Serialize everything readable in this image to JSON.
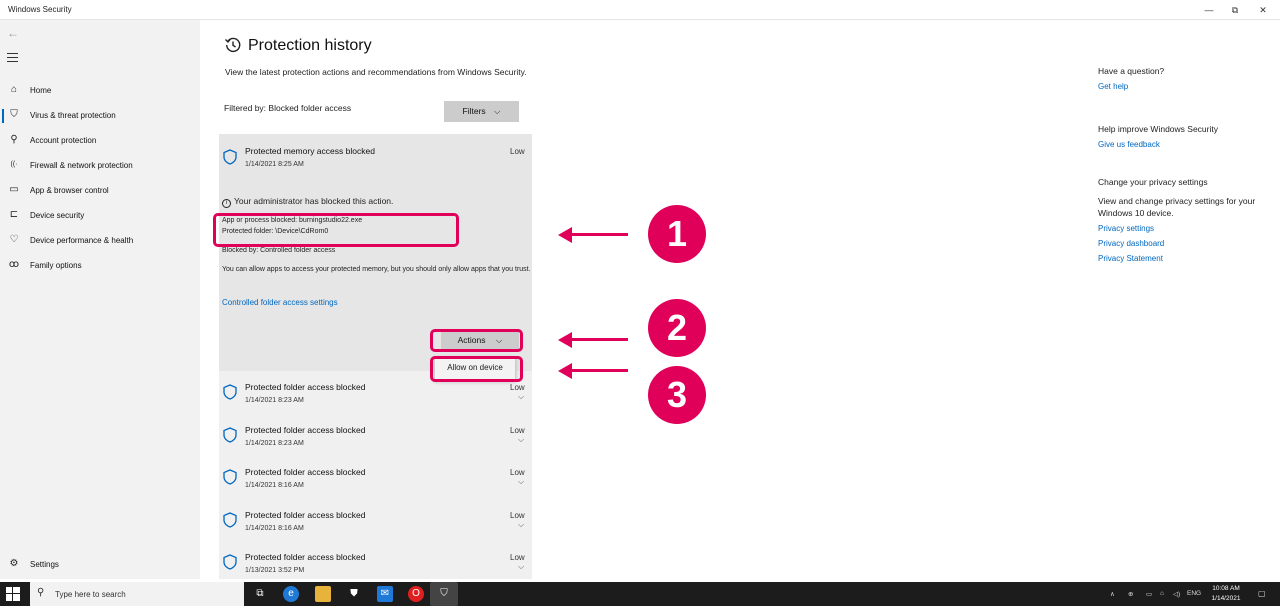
{
  "window": {
    "title": "Windows Security",
    "minimize": "—",
    "restore": "⧉",
    "close": "✕"
  },
  "sidebar": {
    "items": [
      {
        "label": "Home",
        "icon": "home-icon",
        "glyph": "⌂"
      },
      {
        "label": "Virus & threat protection",
        "icon": "shield-icon",
        "glyph": "⛉",
        "active": true
      },
      {
        "label": "Account protection",
        "icon": "person-icon",
        "glyph": "⚲"
      },
      {
        "label": "Firewall & network protection",
        "icon": "wifi-icon",
        "glyph": "((·"
      },
      {
        "label": "App & browser control",
        "icon": "window-icon",
        "glyph": "▭"
      },
      {
        "label": "Device security",
        "icon": "laptop-icon",
        "glyph": "⊏"
      },
      {
        "label": "Device performance & health",
        "icon": "heart-icon",
        "glyph": "♡"
      },
      {
        "label": "Family options",
        "icon": "family-icon",
        "glyph": "ꝏ"
      }
    ],
    "settings_label": "Settings"
  },
  "main": {
    "title": "Protection history",
    "description": "View the latest protection actions and recommendations from Windows Security.",
    "filter_label": "Filtered by: Blocked folder access",
    "filters_button": "Filters"
  },
  "expanded_item": {
    "title": "Protected memory access blocked",
    "date": "1/14/2021 8:25 AM",
    "severity": "Low",
    "admin_notice": "Your administrator has blocked this action.",
    "app_blocked": "App or process blocked: burningstudio22.exe",
    "protected_folder": "Protected folder: \\Device\\CdRom0",
    "blocked_by": "Blocked by: Controlled folder access",
    "info": "You can allow apps to access your protected memory, but you should only allow apps that you trust.",
    "settings_link": "Controlled folder access settings",
    "actions_button": "Actions",
    "dropdown_option": "Allow on device"
  },
  "history_items": [
    {
      "title": "Protected folder access blocked",
      "date": "1/14/2021 8:23 AM",
      "severity": "Low"
    },
    {
      "title": "Protected folder access blocked",
      "date": "1/14/2021 8:23 AM",
      "severity": "Low"
    },
    {
      "title": "Protected folder access blocked",
      "date": "1/14/2021 8:16 AM",
      "severity": "Low"
    },
    {
      "title": "Protected folder access blocked",
      "date": "1/14/2021 8:16 AM",
      "severity": "Low"
    },
    {
      "title": "Protected folder access blocked",
      "date": "1/13/2021 3:52 PM",
      "severity": "Low"
    }
  ],
  "side_panel": {
    "question_heading": "Have a question?",
    "get_help": "Get help",
    "improve_heading": "Help improve Windows Security",
    "feedback": "Give us feedback",
    "privacy_heading": "Change your privacy settings",
    "privacy_text": "View and change privacy settings for your Windows 10 device.",
    "privacy_settings": "Privacy settings",
    "privacy_dashboard": "Privacy dashboard",
    "privacy_statement": "Privacy Statement"
  },
  "annotations": [
    "1",
    "2",
    "3"
  ],
  "colors": {
    "accent": "#0067c0",
    "annotation": "#e0005a",
    "taskbar": "#1c1c1c"
  },
  "taskbar": {
    "search_placeholder": "Type here to search",
    "language": "ENG",
    "time": "10:08 AM",
    "date": "1/14/2021"
  }
}
